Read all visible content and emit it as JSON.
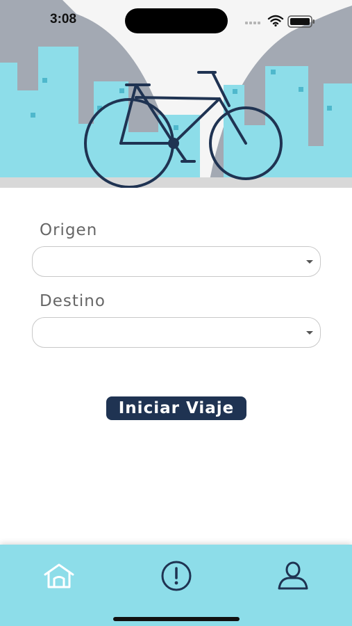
{
  "status_bar": {
    "time": "3:08"
  },
  "form": {
    "origin_label": "Origen",
    "origin_value": "",
    "destination_label": "Destino",
    "destination_value": ""
  },
  "actions": {
    "start_label": "Iniciar Viaje"
  },
  "tab_bar": {
    "items": [
      {
        "name": "home",
        "icon": "home-icon",
        "active": true
      },
      {
        "name": "alerts",
        "icon": "exclamation-circle-icon",
        "active": false
      },
      {
        "name": "profile",
        "icon": "user-icon",
        "active": false
      }
    ]
  },
  "colors": {
    "primary": "#1f3352",
    "accent": "#8ddde9",
    "building": "#8ddde9",
    "skyline_gray": "#a3a9b3",
    "tab_active": "#ffffff",
    "tab_inactive": "#1f3352"
  }
}
